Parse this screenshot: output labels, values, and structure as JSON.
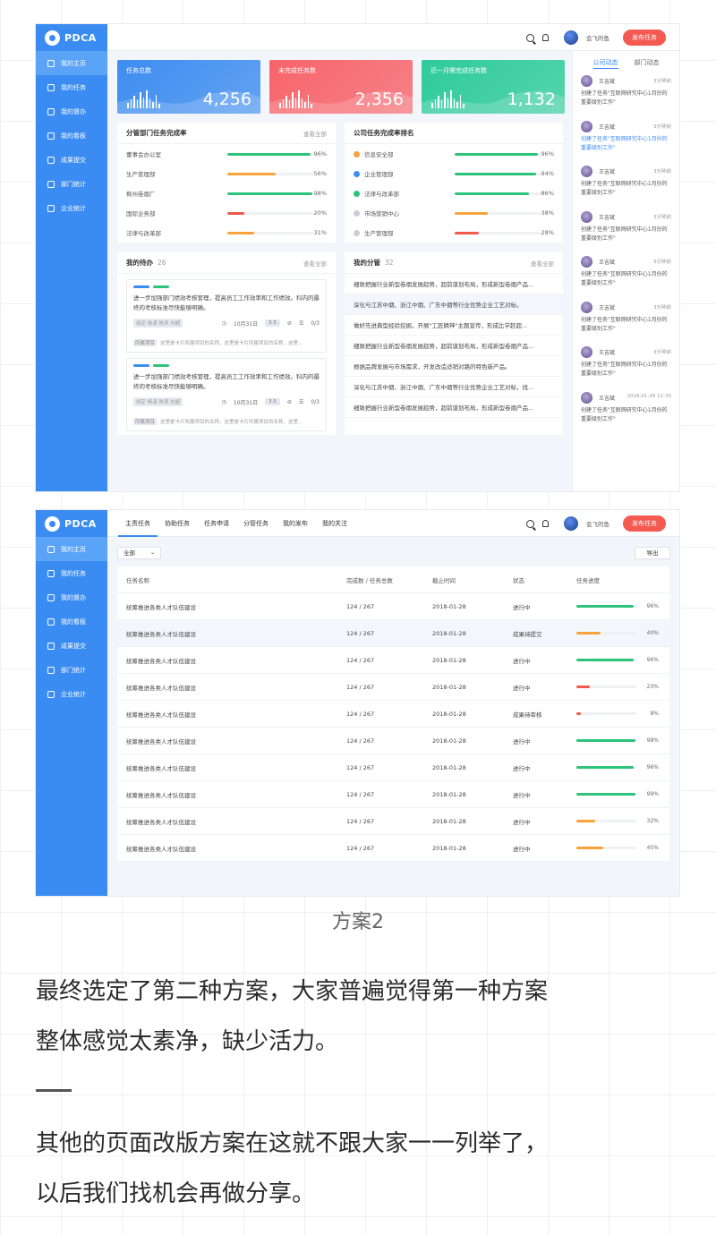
{
  "app": {
    "logo": "PDCA",
    "user": "会飞的鱼",
    "publish": "发布任务"
  },
  "sidebar": [
    {
      "label": "我的主页",
      "icon": "home-icon"
    },
    {
      "label": "我的任务",
      "icon": "task-icon"
    },
    {
      "label": "我的督办",
      "icon": "supervise-icon"
    },
    {
      "label": "我的看板",
      "icon": "board-icon"
    },
    {
      "label": "成果提交",
      "icon": "submit-icon"
    },
    {
      "label": "部门统计",
      "icon": "dept-stats-icon"
    },
    {
      "label": "企业统计",
      "icon": "company-stats-icon"
    }
  ],
  "screen1": {
    "stats": [
      {
        "label": "任务总数",
        "value": "4,256",
        "color": "#3e8df0"
      },
      {
        "label": "未完成任务数",
        "value": "2,356",
        "color": "#f7646a"
      },
      {
        "label": "近一月需完成任务数",
        "value": "1,132",
        "color": "#2ecb9a"
      }
    ],
    "dept": {
      "title": "分管部门任务完成率",
      "more": "查看全部",
      "rows": [
        {
          "name": "董事会办公室",
          "pct": "96%",
          "v": 0.96,
          "color": "#2ec37a"
        },
        {
          "name": "生产管理部",
          "pct": "56%",
          "v": 0.56,
          "color": "#f7a33a"
        },
        {
          "name": "柳州卷烟厂",
          "pct": "98%",
          "v": 0.98,
          "color": "#2ec37a"
        },
        {
          "name": "国际业务部",
          "pct": "20%",
          "v": 0.2,
          "color": "#f05a4a"
        },
        {
          "name": "法律与改革部",
          "pct": "31%",
          "v": 0.31,
          "color": "#f7a33a"
        }
      ]
    },
    "rank": {
      "title": "公司任务完成率排名",
      "rows": [
        {
          "name": "信息安全部",
          "pct": "96%",
          "v": 0.96,
          "color": "#2ec37a",
          "medal": "#f2a33b"
        },
        {
          "name": "企业管理部",
          "pct": "94%",
          "v": 0.94,
          "color": "#2ec37a",
          "medal": "#3e8df0"
        },
        {
          "name": "法律与改革部",
          "pct": "86%",
          "v": 0.86,
          "color": "#2ec37a",
          "medal": "#2ec37a"
        },
        {
          "name": "市场营销中心",
          "pct": "38%",
          "v": 0.38,
          "color": "#f7a33a",
          "medal": "#c9ced8"
        },
        {
          "name": "生产管理部",
          "pct": "28%",
          "v": 0.28,
          "color": "#f05a4a",
          "medal": "#c9ced8"
        }
      ]
    },
    "todo": {
      "title": "我的待办",
      "count": "26",
      "more": "查看全部",
      "items": [
        {
          "text": "进一步加强部门绩效考核管理，提高员工工作效率和工作绩效。科内的最终的考核标准尽快能够明确。",
          "people": "胡定 杨潇 陈滨 刘超",
          "date": "10月31日",
          "score": "3.5",
          "sub": "0/3",
          "project": "所属项目",
          "desc": "这里是卡片所属项目的名称，这里是卡片所属项目的名称，这里..."
        },
        {
          "text": "进一步加强部门绩效考核管理，提高员工工作效率和工作绩效。科内的最终的考核标准尽快能够明确。",
          "people": "胡定 杨潇 陈滨 刘超",
          "date": "10月31日",
          "score": "3.5",
          "sub": "0/3",
          "project": "所属项目",
          "desc": "这里是卡片所属项目的名称，这里是卡片所属项目的名称，这里..."
        }
      ]
    },
    "manage": {
      "title": "我的分管",
      "count": "32",
      "more": "查看全部",
      "rows": [
        "细致把握行业新型卷烟发展趋势，超前谋划布局，形成新型卷烟产品...",
        "深化与江苏中烟、浙江中烟、广东中烟等行业优势企业工艺对标。",
        "做好先进典型经验挖掘，开展\"工匠精神\"主题宣传，形成比学赶超...",
        "细致把握行业新型卷烟发展趋势，超前谋划布局，形成新型卷烟产品...",
        "根据品牌发展与市场需求，开发改造适销对路的特色新产品。",
        "深化与江苏中烟、浙江中烟、广东中烟等行业优势企业工艺对标，找...",
        "细致把握行业新型卷烟发展趋势，超前谋划布局，形成新型卷烟产品..."
      ]
    },
    "feed": {
      "tabs": [
        "公司动态",
        "部门动态"
      ],
      "items": [
        {
          "who": "王吉斌",
          "time": "3分钟前",
          "text": "创建了任务\"互联网研究中心1月份的重要级别工作\"",
          "blue": false
        },
        {
          "who": "王吉斌",
          "time": "3分钟前",
          "text": "创建了任务\"互联网研究中心1月份的重要级别工作\"",
          "blue": true
        },
        {
          "who": "王吉斌",
          "time": "3分钟前",
          "text": "创建了任务\"互联网研究中心1月份的重要级别工作\"",
          "blue": false
        },
        {
          "who": "王吉斌",
          "time": "3分钟前",
          "text": "创建了任务\"互联网研究中心1月份的重要级别工作\"",
          "blue": false
        },
        {
          "who": "王吉斌",
          "time": "3分钟前",
          "text": "创建了任务\"互联网研究中心1月份的重要级别工作\"",
          "blue": false
        },
        {
          "who": "王吉斌",
          "time": "3分钟前",
          "text": "创建了任务\"互联网研究中心1月份的重要级别工作\"",
          "blue": false
        },
        {
          "who": "王吉斌",
          "time": "3分钟前",
          "text": "创建了任务\"互联网研究中心1月份的重要级别工作\"",
          "blue": false
        },
        {
          "who": "王吉斌",
          "time": "2018-01-26  11:30",
          "text": "创建了任务\"互联网研究中心1月份的重要级别工作\"",
          "blue": false
        }
      ]
    }
  },
  "screen2": {
    "tabs": [
      "主责任务",
      "协助任务",
      "任务申请",
      "分管任务",
      "我的发布",
      "我的关注"
    ],
    "filter": "全部",
    "export": "导出",
    "columns": [
      "任务名称",
      "完成数 / 任务总数",
      "截止时间",
      "状态",
      "任务进度"
    ],
    "rows": [
      {
        "name": "统筹推进各类人才队伍建设",
        "count": "124 / 267",
        "date": "2018-01-28",
        "status": "进行中",
        "pct": "96%",
        "v": 0.96,
        "color": "#2ec37a"
      },
      {
        "name": "统筹推进各类人才队伍建设",
        "count": "124 / 267",
        "date": "2018-01-28",
        "status": "成果待提交",
        "pct": "40%",
        "v": 0.4,
        "color": "#f7a33a"
      },
      {
        "name": "统筹推进各类人才队伍建设",
        "count": "124 / 267",
        "date": "2018-01-28",
        "status": "进行中",
        "pct": "96%",
        "v": 0.96,
        "color": "#2ec37a"
      },
      {
        "name": "统筹推进各类人才队伍建设",
        "count": "124 / 267",
        "date": "2018-01-28",
        "status": "进行中",
        "pct": "23%",
        "v": 0.23,
        "color": "#f05a4a"
      },
      {
        "name": "统筹推进各类人才队伍建设",
        "count": "124 / 267",
        "date": "2018-01-28",
        "status": "成果待审核",
        "pct": "8%",
        "v": 0.08,
        "color": "#f05a4a"
      },
      {
        "name": "统筹推进各类人才队伍建设",
        "count": "124 / 267",
        "date": "2018-01-28",
        "status": "进行中",
        "pct": "98%",
        "v": 0.98,
        "color": "#2ec37a"
      },
      {
        "name": "统筹推进各类人才队伍建设",
        "count": "124 / 267",
        "date": "2018-01-28",
        "status": "进行中",
        "pct": "96%",
        "v": 0.96,
        "color": "#2ec37a"
      },
      {
        "name": "统筹推进各类人才队伍建设",
        "count": "124 / 267",
        "date": "2018-01-28",
        "status": "进行中",
        "pct": "99%",
        "v": 0.99,
        "color": "#2ec37a"
      },
      {
        "name": "统筹推进各类人才队伍建设",
        "count": "124 / 267",
        "date": "2018-01-28",
        "status": "进行中",
        "pct": "32%",
        "v": 0.32,
        "color": "#f7a33a"
      },
      {
        "name": "统筹推进各类人才队伍建设",
        "count": "124 / 267",
        "date": "2018-01-28",
        "status": "进行中",
        "pct": "45%",
        "v": 0.45,
        "color": "#f7a33a"
      }
    ]
  },
  "caption": "方案2",
  "para1": [
    "最终选定了第二种方案，大家普遍觉得第一种方案",
    "整体感觉太素净，缺少活力。"
  ],
  "para2": [
    "其他的页面改版方案在这就不跟大家一一列举了，",
    "以后我们找机会再做分享。"
  ]
}
